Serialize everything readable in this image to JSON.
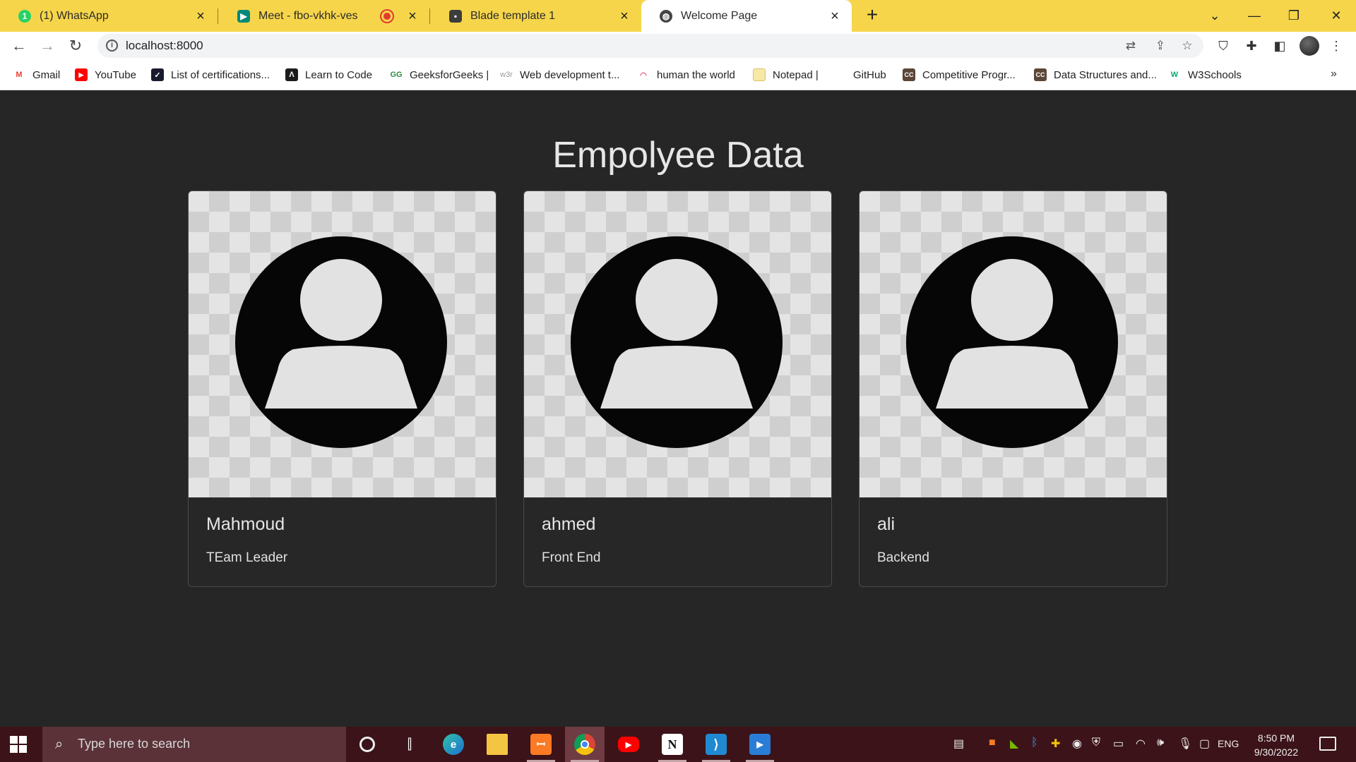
{
  "tabs": [
    {
      "title": "(1) WhatsApp",
      "icon": "whatsapp-icon",
      "color": "#25d366",
      "badge": "1"
    },
    {
      "title": "Meet - fbo-vkhk-ves",
      "icon": "google-meet-icon",
      "color": "#00897b"
    },
    {
      "title": "Blade template 1",
      "icon": "template-icon",
      "color": "#333333"
    },
    {
      "title": "Welcome Page",
      "icon": "globe-icon",
      "color": "#333333"
    }
  ],
  "address_bar": {
    "url": "localhost:8000"
  },
  "bookmarks": [
    {
      "label": "Gmail",
      "icon": "gmail-icon"
    },
    {
      "label": "YouTube",
      "icon": "youtube-icon"
    },
    {
      "label": "List of certifications...",
      "icon": "certifications-icon"
    },
    {
      "label": "Learn to Code",
      "icon": "code-icon"
    },
    {
      "label": "GeeksforGeeks |",
      "icon": "geeksforgeeks-icon"
    },
    {
      "label": "Web development t...",
      "icon": "w3r-icon"
    },
    {
      "label": "human the world",
      "icon": "human-icon"
    },
    {
      "label": "Notepad |",
      "icon": "notepad-icon"
    },
    {
      "label": "GitHub",
      "icon": "github-icon"
    },
    {
      "label": "Competitive Progr...",
      "icon": "cc-icon"
    },
    {
      "label": "Data Structures and...",
      "icon": "cc-icon"
    },
    {
      "label": "W3Schools",
      "icon": "w3schools-icon"
    }
  ],
  "page": {
    "title": "Empolyee Data",
    "employees": [
      {
        "name": "Mahmoud",
        "role": "TEam Leader"
      },
      {
        "name": "ahmed",
        "role": "Front End"
      },
      {
        "name": "ali",
        "role": "Backend"
      }
    ]
  },
  "taskbar": {
    "search_placeholder": "Type here to search",
    "language": "ENG",
    "time": "8:50 PM",
    "date": "9/30/2022"
  },
  "colors": {
    "tab_strip": "#f6d54a",
    "page_background": "#262626",
    "taskbar": "#3b1318"
  }
}
